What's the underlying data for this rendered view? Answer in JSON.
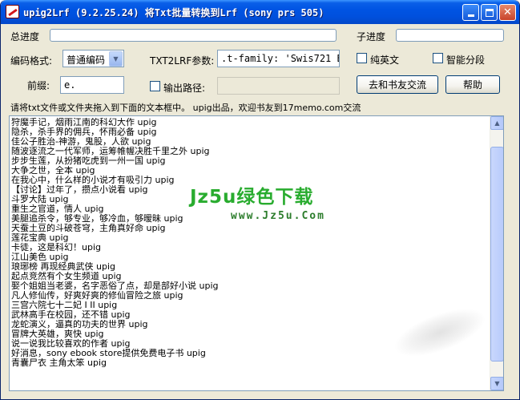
{
  "window": {
    "title": "upig2Lrf (9.2.25.24) 将Txt批量转换到Lrf (sony prs 505)"
  },
  "progress": {
    "total_label": "总进度",
    "sub_label": "子进度"
  },
  "encoding": {
    "label": "编码格式:",
    "selected": "普通编码"
  },
  "txt2lrf": {
    "label": "TXT2LRF参数:",
    "value": ".t-family: 'Swis721 BT'}\""
  },
  "options": {
    "pure_english": "纯英文",
    "smart_split": "智能分段",
    "output_path": "输出路径:"
  },
  "prefix": {
    "label": "前缀:",
    "value": "e."
  },
  "buttons": {
    "share": "去和书友交流",
    "help": "帮助"
  },
  "instruction": "请将txt文件或文件夹拖入到下面的文本框中。   upig出品，欢迎书友到17memo.com交流",
  "text_lines": [
    "狩魔手记，烟雨江南的科幻大作 upig",
    "隐杀，杀手界的佣兵，怀雨必备 upig",
    "佳公子胜治-神游，鬼股，人欲 upig",
    "随波逐流之一代军师，运筹帷幄决胜千里之外 upig",
    "步步生莲，从扮猪吃虎到一州一国 upig",
    "大争之世，全本 upig",
    "在我心中，什么样的小说才有吸引力 upig",
    "【讨论】过年了，攒点小说看 upig",
    "斗罗大陆 upig",
    "重生之官道，情人 upig",
    "美腿追杀令，够专业，够冷血，够暧昧 upig",
    "天蚕土豆的斗破苍穹，主角真好命 upig",
    "莲花宝典 upig",
    "卡徒，这是科幻！upig",
    "江山美色 upig",
    "琅琊榜 再现经典武侠 upig",
    "起点竞然有个女生频道 upig",
    "娶个姐姐当老婆，名字恶俗了点，却是部好小说 upig",
    "凡人修仙传，好爽好爽的修仙冒险之旅 upig",
    "三宫六院七十二妃 I II upig",
    "武林高手在校园，还不错 upig",
    "龙蛇演义，逼真的功夫的世界 upig",
    "冒牌大英雄，爽快 upig",
    "说一说我比较喜欢的作者 upig",
    "好消息，sony ebook store提供免费电子书 upig",
    "青囊尸衣 主角太笨 upig"
  ],
  "watermark": {
    "brand": "Jz5u绿色下载",
    "url": "www.Jz5u.Com"
  },
  "colors": {
    "titlebar": "#0054e3",
    "window_bg": "#ece9d8",
    "field_border": "#7f9db9",
    "watermark_green": "#17a51e"
  }
}
